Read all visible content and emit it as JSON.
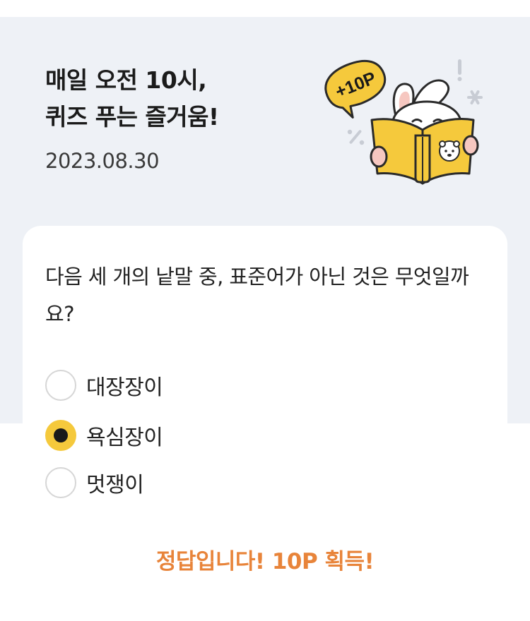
{
  "header": {
    "title_line1": "매일 오전 10시,",
    "title_line2": "퀴즈 푸는 즐거움!",
    "date": "2023.08.30",
    "illustration": {
      "icon": "rabbit-reading-book-icon",
      "badge_text": "+10P",
      "accent_color": "#f5c93c"
    }
  },
  "quiz": {
    "question": "다음 세 개의 낱말 중, 표준어가 아닌 것은 무엇일까요?",
    "options": [
      {
        "label": "대장장이",
        "selected": false
      },
      {
        "label": "욕심장이",
        "selected": true
      },
      {
        "label": "멋쟁이",
        "selected": false
      }
    ],
    "result_text": "정답입니다! 10P 획득!",
    "result_color": "#e8843a"
  }
}
